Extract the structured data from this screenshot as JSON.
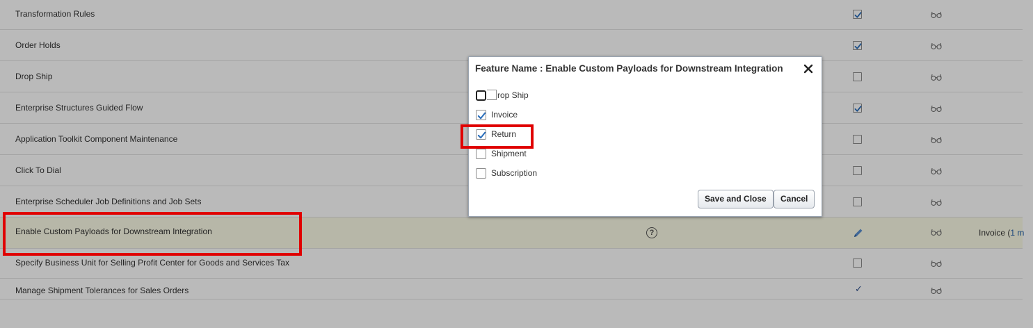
{
  "features": [
    {
      "name": "Transformation Rules",
      "control": "checked"
    },
    {
      "name": "Order Holds",
      "control": "checked"
    },
    {
      "name": "Drop Ship",
      "control": "unchecked"
    },
    {
      "name": "Enterprise Structures Guided Flow",
      "control": "checked"
    },
    {
      "name": "Application Toolkit Component Maintenance",
      "control": "unchecked"
    },
    {
      "name": "Click To Dial",
      "control": "unchecked"
    },
    {
      "name": "Enterprise Scheduler Job Definitions and Job Sets",
      "control": "unchecked"
    },
    {
      "name": "Enable Custom Payloads for Downstream Integration",
      "control": "edit",
      "selected": true,
      "help": "?",
      "values": "Invoice (",
      "values_link": "1 m"
    },
    {
      "name": "Specify Business Unit for Selling Profit Center for Goods and Services Tax",
      "control": "unchecked"
    },
    {
      "name": "Manage Shipment Tolerances for Sales Orders",
      "control": "tick",
      "tick_glyph": "✓"
    }
  ],
  "icons": {
    "row_action": "glasses-icon",
    "edit": "pencil-icon",
    "close": "close-icon"
  },
  "dialog": {
    "title": "Feature Name : Enable Custom Payloads for Downstream Integration",
    "options": [
      {
        "label": "rop Ship",
        "checked": false,
        "focused": true
      },
      {
        "label": "Invoice",
        "checked": true
      },
      {
        "label": "Return",
        "checked": true
      },
      {
        "label": "Shipment",
        "checked": false
      },
      {
        "label": "Subscription",
        "checked": false
      }
    ],
    "save_label": "Save and Close",
    "cancel_label": "Cancel"
  },
  "colors": {
    "highlight": "#e00000",
    "check": "#2a6ebb",
    "selected_row": "#fbfbe6"
  }
}
